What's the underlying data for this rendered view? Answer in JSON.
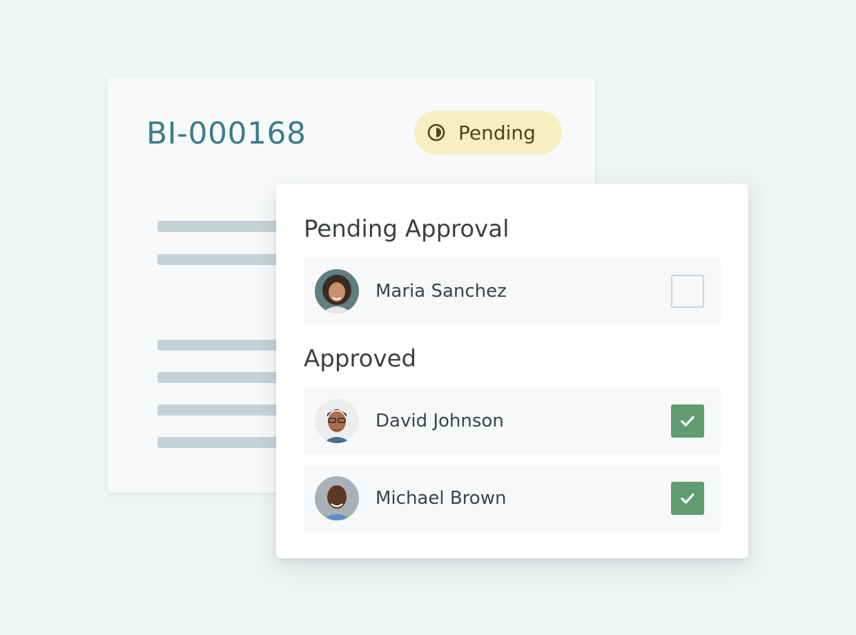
{
  "document": {
    "id": "BI-000168",
    "status": {
      "label": "Pending",
      "icon": "half-circle-icon",
      "background": "#f6efc3",
      "color": "#4f4510"
    }
  },
  "approval_panel": {
    "pending_heading": "Pending Approval",
    "approved_heading": "Approved",
    "pending": [
      {
        "name": "Maria Sanchez",
        "checked": false
      }
    ],
    "approved": [
      {
        "name": "David Johnson",
        "checked": true
      },
      {
        "name": "Michael Brown",
        "checked": true
      }
    ],
    "check_color": "#5f9c70"
  }
}
